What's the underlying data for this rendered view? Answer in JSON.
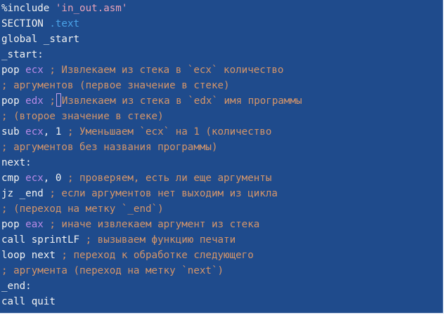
{
  "editor": {
    "background": "#1f4b8c",
    "colors": {
      "text": "#f2f2f2",
      "string": "#e8a2b8",
      "section": "#4aa3e8",
      "register": "#b88ae6",
      "comment": "#d4956a"
    },
    "cursor": {
      "line": 6
    },
    "lines": [
      [
        {
          "t": "%include ",
          "c": "text"
        },
        {
          "t": "'in_out.asm'",
          "c": "string"
        }
      ],
      [
        {
          "t": "SECTION ",
          "c": "text"
        },
        {
          "t": ".text",
          "c": "section"
        }
      ],
      [
        {
          "t": "global _start",
          "c": "text"
        }
      ],
      [
        {
          "t": "_start:",
          "c": "text"
        }
      ],
      [
        {
          "t": "pop ",
          "c": "text"
        },
        {
          "t": "ecx",
          "c": "reg"
        },
        {
          "t": " ; Извлекаем из стека в `ecx` количество",
          "c": "comment"
        }
      ],
      [
        {
          "t": "; аргументов (первое значение в стеке)",
          "c": "comment"
        }
      ],
      [
        {
          "t": "pop ",
          "c": "text"
        },
        {
          "t": "edx",
          "c": "reg"
        },
        {
          "t": " ;",
          "c": "comment"
        },
        {
          "t": "",
          "c": "cursor"
        },
        {
          "t": "Извлекаем из стека в `edx` имя программы",
          "c": "comment"
        }
      ],
      [
        {
          "t": "; (второе значение в стеке)",
          "c": "comment"
        }
      ],
      [
        {
          "t": "sub ",
          "c": "text"
        },
        {
          "t": "ecx",
          "c": "reg"
        },
        {
          "t": ", 1 ",
          "c": "text"
        },
        {
          "t": "; Уменьшаем `ecx` на 1 (количество",
          "c": "comment"
        }
      ],
      [
        {
          "t": "; аргументов без названия программы)",
          "c": "comment"
        }
      ],
      [
        {
          "t": "next:",
          "c": "text"
        }
      ],
      [
        {
          "t": "cmp ",
          "c": "text"
        },
        {
          "t": "ecx",
          "c": "reg"
        },
        {
          "t": ", 0 ",
          "c": "text"
        },
        {
          "t": "; проверяем, есть ли еще аргументы",
          "c": "comment"
        }
      ],
      [
        {
          "t": "jz _end ",
          "c": "text"
        },
        {
          "t": "; если аргументов нет выходим из цикла",
          "c": "comment"
        }
      ],
      [
        {
          "t": "; (переход на метку `_end`)",
          "c": "comment"
        }
      ],
      [
        {
          "t": "pop ",
          "c": "text"
        },
        {
          "t": "eax",
          "c": "reg"
        },
        {
          "t": " ; иначе извлекаем аргумент из стека",
          "c": "comment"
        }
      ],
      [
        {
          "t": "call sprintLF ",
          "c": "text"
        },
        {
          "t": "; вызываем функцию печати",
          "c": "comment"
        }
      ],
      [
        {
          "t": "loop next ",
          "c": "text"
        },
        {
          "t": "; переход к обработке следующего",
          "c": "comment"
        }
      ],
      [
        {
          "t": "; аргумента (переход на метку `next`)",
          "c": "comment"
        }
      ],
      [
        {
          "t": "_end:",
          "c": "text"
        }
      ],
      [
        {
          "t": "call quit",
          "c": "text"
        }
      ]
    ]
  }
}
